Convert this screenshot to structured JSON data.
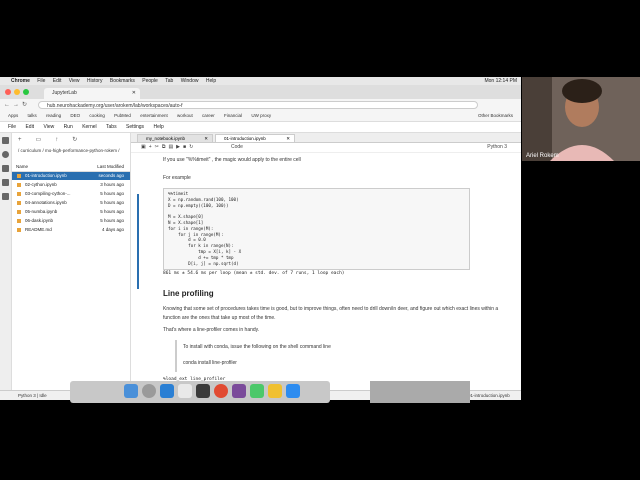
{
  "menubar": {
    "app": "Chrome",
    "items": [
      "File",
      "Edit",
      "View",
      "History",
      "Bookmarks",
      "People",
      "Tab",
      "Window",
      "Help"
    ],
    "clock": "Mon 12:14 PM"
  },
  "browser": {
    "tab_title": "JupyterLab",
    "url": "hub.neurohackademy.org/user/arokem/lab/workspaces/auto-f",
    "bookmarks": [
      "Apps",
      "talks",
      "reading",
      "DEO",
      "cooking",
      "PubMed",
      "entertainment",
      "workout",
      "career",
      "Financial",
      "UW proxy"
    ],
    "other_bookmarks": "Other Bookmarks"
  },
  "jupyter": {
    "menu": [
      "File",
      "Edit",
      "View",
      "Run",
      "Kernel",
      "Tabs",
      "Settings",
      "Help"
    ],
    "filebrowser": {
      "breadcrumb": "/ curriculum / mo-high-performance-python-rokem /",
      "col_name": "Name",
      "col_modified": "Last Modified",
      "files": [
        {
          "name": "01-introduction.ipynb",
          "time": "seconds ago",
          "selected": true
        },
        {
          "name": "02-cython.ipynb",
          "time": "3 hours ago",
          "selected": false
        },
        {
          "name": "03-compiling-cython-...",
          "time": "5 hours ago",
          "selected": false
        },
        {
          "name": "04-annotations.ipynb",
          "time": "5 hours ago",
          "selected": false
        },
        {
          "name": "05-numba.ipynb",
          "time": "5 hours ago",
          "selected": false
        },
        {
          "name": "06-dask.ipynb",
          "time": "5 hours ago",
          "selected": false
        },
        {
          "name": "README.md",
          "time": "4 days ago",
          "selected": false
        }
      ]
    },
    "tabs": [
      {
        "label": "my_notebook.ipynb",
        "active": false
      },
      {
        "label": "01-introduction.ipynb",
        "active": true
      }
    ],
    "toolbar": {
      "cell_type": "Code",
      "kernel": "Python 3"
    },
    "notebook": {
      "md_line1": "If you use \"%%timeit\" , the magic would apply to the entire cell",
      "md_line2": "For example",
      "code": "%%timeit\nX = np.random.rand(100, 100)\nD = np.empty((100, 100))\n\nM = X.shape[0]\nN = X.shape[1]\nfor i in range(M):\n    for j in range(M):\n        d = 0.0\n        for k in range(N):\n            tmp = X[i, k] - X\n            d += tmp * tmp\n        D[i, j] = np.sqrt(d)",
      "output": "861 ms ± 54.6 ms per loop (mean ± std. dev. of 7 runs, 1 loop each)",
      "heading": "Line profiling",
      "paragraph1": "Knowing that some set of procedures takes time is good, but to improve things, often need to drill down/in deer, and figure out which exact lines within a function are the ones that take up most of the time.",
      "paragraph2": "That's where a line-profiler comes in handy.",
      "quote1": "To install with conda, issue the following on the shell command line",
      "quote2": "conda install line-profiler",
      "load_ext": "%load_ext line_profiler"
    },
    "status": {
      "kernel": "Python 3 | Idle",
      "mem": "Mem: 343.74 MB",
      "saving": "Saving completed",
      "mode": "Mode: Edit",
      "position": "Ln 10, Col 27",
      "file": "01-introduction.ipynb"
    }
  },
  "webcam": {
    "name": "Ariel Rokem"
  }
}
